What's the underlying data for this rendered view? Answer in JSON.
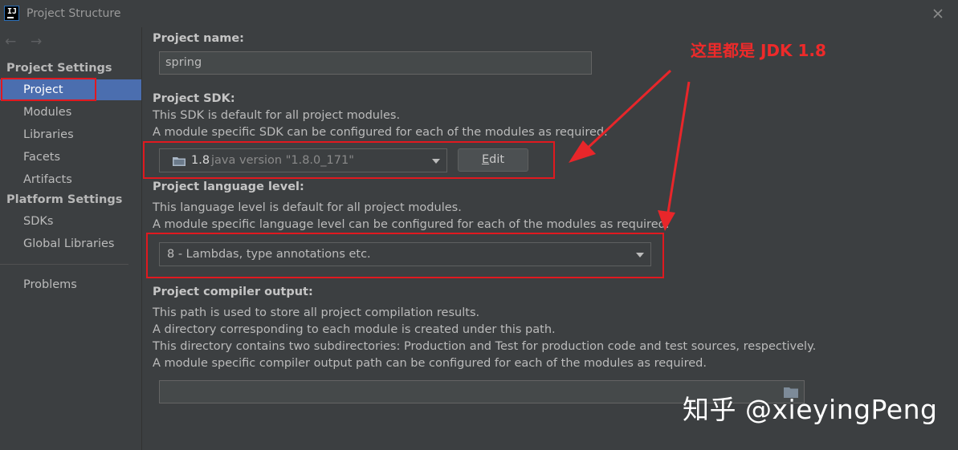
{
  "window": {
    "title": "Project Structure"
  },
  "sidebar": {
    "sections": [
      {
        "title": "Project Settings",
        "items": [
          "Project",
          "Modules",
          "Libraries",
          "Facets",
          "Artifacts"
        ]
      },
      {
        "title": "Platform Settings",
        "items": [
          "SDKs",
          "Global Libraries"
        ]
      }
    ],
    "problems": "Problems",
    "selected": "Project"
  },
  "project_name": {
    "label": "Project name:",
    "value": "spring"
  },
  "project_sdk": {
    "label": "Project SDK:",
    "desc1": "This SDK is default for all project modules.",
    "desc2": "A module specific SDK can be configured for each of the modules as required.",
    "sdk_name": "1.8",
    "sdk_version": "java version \"1.8.0_171\"",
    "edit_mnemonic": "E",
    "edit_rest": "dit"
  },
  "language_level": {
    "label": "Project language level:",
    "desc1": "This language level is default for all project modules.",
    "desc2": "A module specific language level can be configured for each of the modules as required.",
    "value": "8 - Lambdas, type annotations etc."
  },
  "compiler_output": {
    "label": "Project compiler output:",
    "desc1": "This path is used to store all project compilation results.",
    "desc2": "A directory corresponding to each module is created under this path.",
    "desc3": "This directory contains two subdirectories: Production and Test for production code and test sources, respectively.",
    "desc4": "A module specific compiler output path can be configured for each of the modules as required.",
    "value": ""
  },
  "annotation": {
    "text": "这里都是 JDK 1.8",
    "color": "#ee2a2a"
  },
  "watermark": "知乎 @xieyingPeng",
  "colors": {
    "selection": "#4b6eaf",
    "background": "#3c3f41",
    "highlight": "#e0191f"
  }
}
